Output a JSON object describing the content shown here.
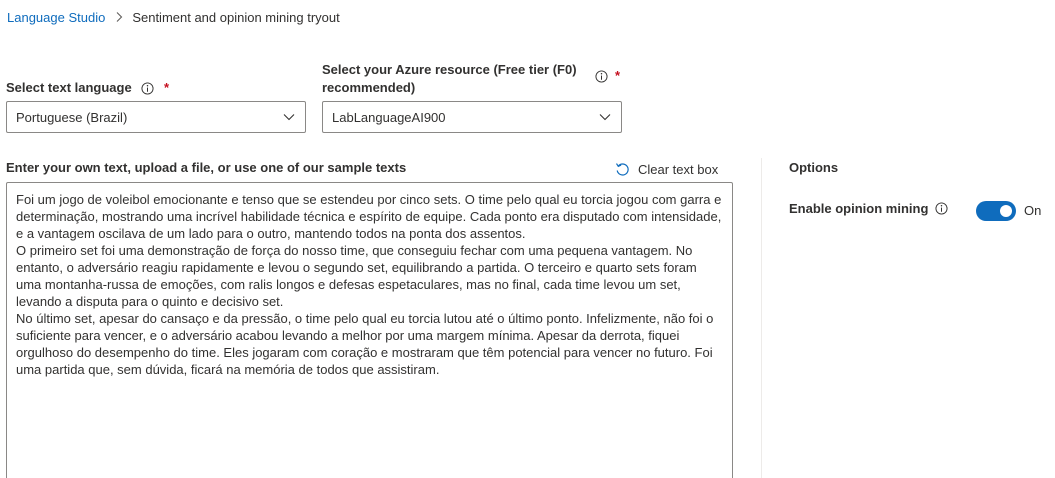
{
  "breadcrumb": {
    "root": "Language Studio",
    "current": "Sentiment and opinion mining tryout"
  },
  "language_field": {
    "label": "Select text language",
    "required_mark": "*",
    "selected": "Portuguese (Brazil)"
  },
  "resource_field": {
    "label_line1": "Select your Azure resource (Free tier (F0)",
    "label_line2": "recommended)",
    "required_mark": "*",
    "selected": "LabLanguageAI900"
  },
  "text_input": {
    "label": "Enter your own text, upload a file, or use one of our sample texts",
    "clear_label": "Clear text box",
    "paragraphs": [
      "Foi um jogo de voleibol emocionante e tenso que se estendeu por cinco sets. O time pelo qual eu torcia jogou com garra e determinação, mostrando uma incrível habilidade técnica e espírito de equipe. Cada ponto era disputado com intensidade, e a vantagem oscilava de um lado para o outro, mantendo todos na ponta dos assentos.",
      "O primeiro set foi uma demonstração de força do nosso time, que conseguiu fechar com uma pequena vantagem. No entanto, o adversário reagiu rapidamente e levou o segundo set, equilibrando a partida. O terceiro e quarto sets foram uma montanha-russa de emoções, com ralis longos e defesas espetaculares, mas no final, cada time levou um set, levando a disputa para o quinto e decisivo set.",
      "No último set, apesar do cansaço e da pressão, o time pelo qual eu torcia lutou até o último ponto. Infelizmente, não foi o suficiente para vencer, e o adversário acabou levando a melhor por uma margem mínima. Apesar da derrota, fiquei orgulhoso do desempenho do time. Eles jogaram com coração e mostraram que têm potencial para vencer no futuro. Foi uma partida que, sem dúvida, ficará na memória de todos que assistiram."
    ]
  },
  "options": {
    "title": "Options",
    "opinion_mining_label": "Enable opinion mining",
    "opinion_mining_state": "On",
    "opinion_mining_enabled": true
  },
  "colors": {
    "accent": "#0f6cbd",
    "required": "#c50f1f",
    "border": "#8a8886"
  }
}
